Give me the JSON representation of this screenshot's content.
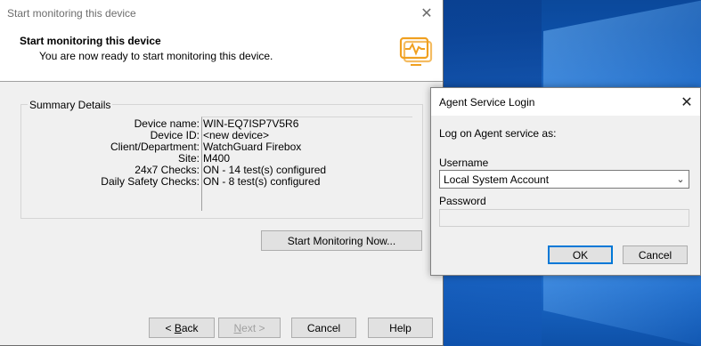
{
  "wizard": {
    "title": "Start monitoring this device",
    "header_title": "Start monitoring this device",
    "header_subtitle": "You are now ready to start monitoring this device.",
    "group_label": "Summary Details",
    "summary": [
      {
        "key": "Device name:",
        "value": "WIN-EQ7ISP7V5R6"
      },
      {
        "key": "Device ID:",
        "value": "<new device>"
      },
      {
        "key": "Client/Department:",
        "value": "WatchGuard Firebox"
      },
      {
        "key": "Site:",
        "value": "M400"
      },
      {
        "key": "24x7 Checks:",
        "value": "ON - 14 test(s) configured"
      },
      {
        "key": "Daily Safety Checks:",
        "value": "ON - 8 test(s) configured"
      }
    ],
    "start_button": "Start Monitoring Now...",
    "back_prefix": "< ",
    "back_accel": "B",
    "back_rest": "ack",
    "next_accel": "N",
    "next_rest": "ext >",
    "cancel_button": "Cancel",
    "help_button": "Help",
    "accent_color": "#f0a020"
  },
  "dialog": {
    "title": "Agent Service Login",
    "prompt": "Log on Agent service as:",
    "username_label": "Username",
    "username_value": "Local System Account",
    "password_label": "Password",
    "password_value": "",
    "ok_button": "OK",
    "cancel_button": "Cancel"
  }
}
